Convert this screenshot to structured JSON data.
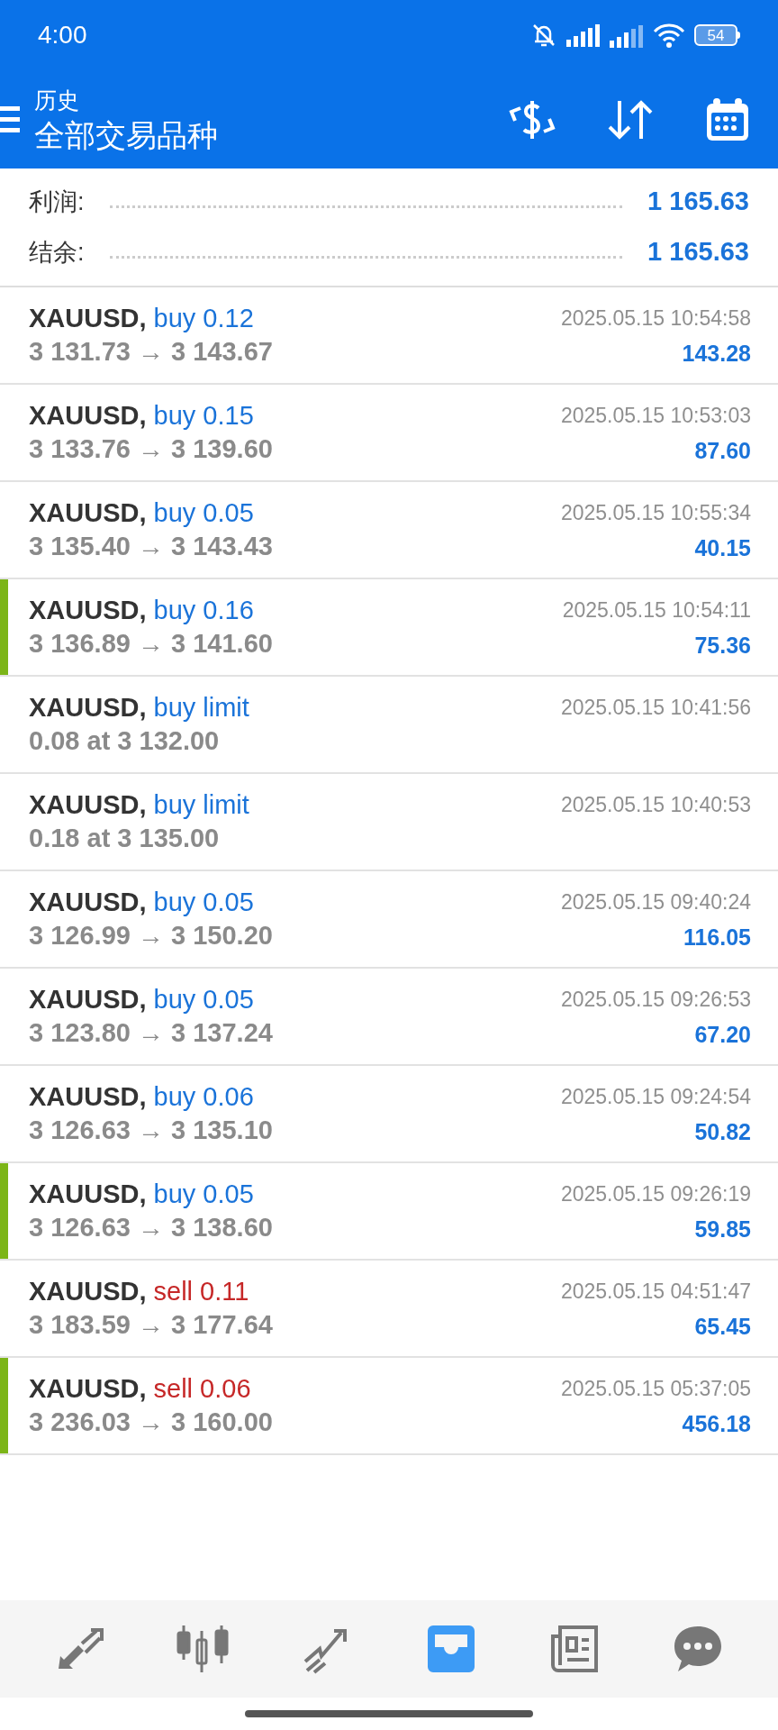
{
  "status_bar": {
    "time": "4:00",
    "battery": "54"
  },
  "header": {
    "title": "历史",
    "subtitle": "全部交易品种"
  },
  "summary": [
    {
      "label": "利润:",
      "value": "1 165.63"
    },
    {
      "label": "结余:",
      "value": "1 165.63"
    }
  ],
  "trades": [
    {
      "symbol": "XAUUSD,",
      "kind": "buy",
      "order": "buy 0.12",
      "prices": "3 131.73 → 3 143.67",
      "time": "2025.05.15 10:54:58",
      "profit": "143.28",
      "marked": false
    },
    {
      "symbol": "XAUUSD,",
      "kind": "buy",
      "order": "buy 0.15",
      "prices": "3 133.76 → 3 139.60",
      "time": "2025.05.15 10:53:03",
      "profit": "87.60",
      "marked": false
    },
    {
      "symbol": "XAUUSD,",
      "kind": "buy",
      "order": "buy 0.05",
      "prices": "3 135.40 → 3 143.43",
      "time": "2025.05.15 10:55:34",
      "profit": "40.15",
      "marked": false
    },
    {
      "symbol": "XAUUSD,",
      "kind": "buy",
      "order": "buy 0.16",
      "prices": "3 136.89 → 3 141.60",
      "time": "2025.05.15 10:54:11",
      "profit": "75.36",
      "marked": true
    },
    {
      "symbol": "XAUUSD,",
      "kind": "buy",
      "order": "buy limit",
      "prices": "0.08 at 3 132.00",
      "time": "2025.05.15 10:41:56",
      "marked": false
    },
    {
      "symbol": "XAUUSD,",
      "kind": "buy",
      "order": "buy limit",
      "prices": "0.18 at 3 135.00",
      "time": "2025.05.15 10:40:53",
      "marked": false
    },
    {
      "symbol": "XAUUSD,",
      "kind": "buy",
      "order": "buy 0.05",
      "prices": "3 126.99 → 3 150.20",
      "time": "2025.05.15 09:40:24",
      "profit": "116.05",
      "marked": false
    },
    {
      "symbol": "XAUUSD,",
      "kind": "buy",
      "order": "buy 0.05",
      "prices": "3 123.80 → 3 137.24",
      "time": "2025.05.15 09:26:53",
      "profit": "67.20",
      "marked": false
    },
    {
      "symbol": "XAUUSD,",
      "kind": "buy",
      "order": "buy 0.06",
      "prices": "3 126.63 → 3 135.10",
      "time": "2025.05.15 09:24:54",
      "profit": "50.82",
      "marked": false
    },
    {
      "symbol": "XAUUSD,",
      "kind": "buy",
      "order": "buy 0.05",
      "prices": "3 126.63 → 3 138.60",
      "time": "2025.05.15 09:26:19",
      "profit": "59.85",
      "marked": true
    },
    {
      "symbol": "XAUUSD,",
      "kind": "sell",
      "order": "sell 0.11",
      "prices": "3 183.59 → 3 177.64",
      "time": "2025.05.15 04:51:47",
      "profit": "65.45",
      "marked": false
    },
    {
      "symbol": "XAUUSD,",
      "kind": "sell",
      "order": "sell 0.06",
      "prices": "3 236.03 → 3 160.00",
      "time": "2025.05.15 05:37:05",
      "profit": "456.18",
      "marked": true
    }
  ],
  "nav": [
    {
      "kind": "quotes",
      "selected": false
    },
    {
      "kind": "chart",
      "selected": false
    },
    {
      "kind": "trade",
      "selected": false
    },
    {
      "kind": "history",
      "selected": true
    },
    {
      "kind": "news",
      "selected": false
    },
    {
      "kind": "messages",
      "selected": false
    }
  ]
}
